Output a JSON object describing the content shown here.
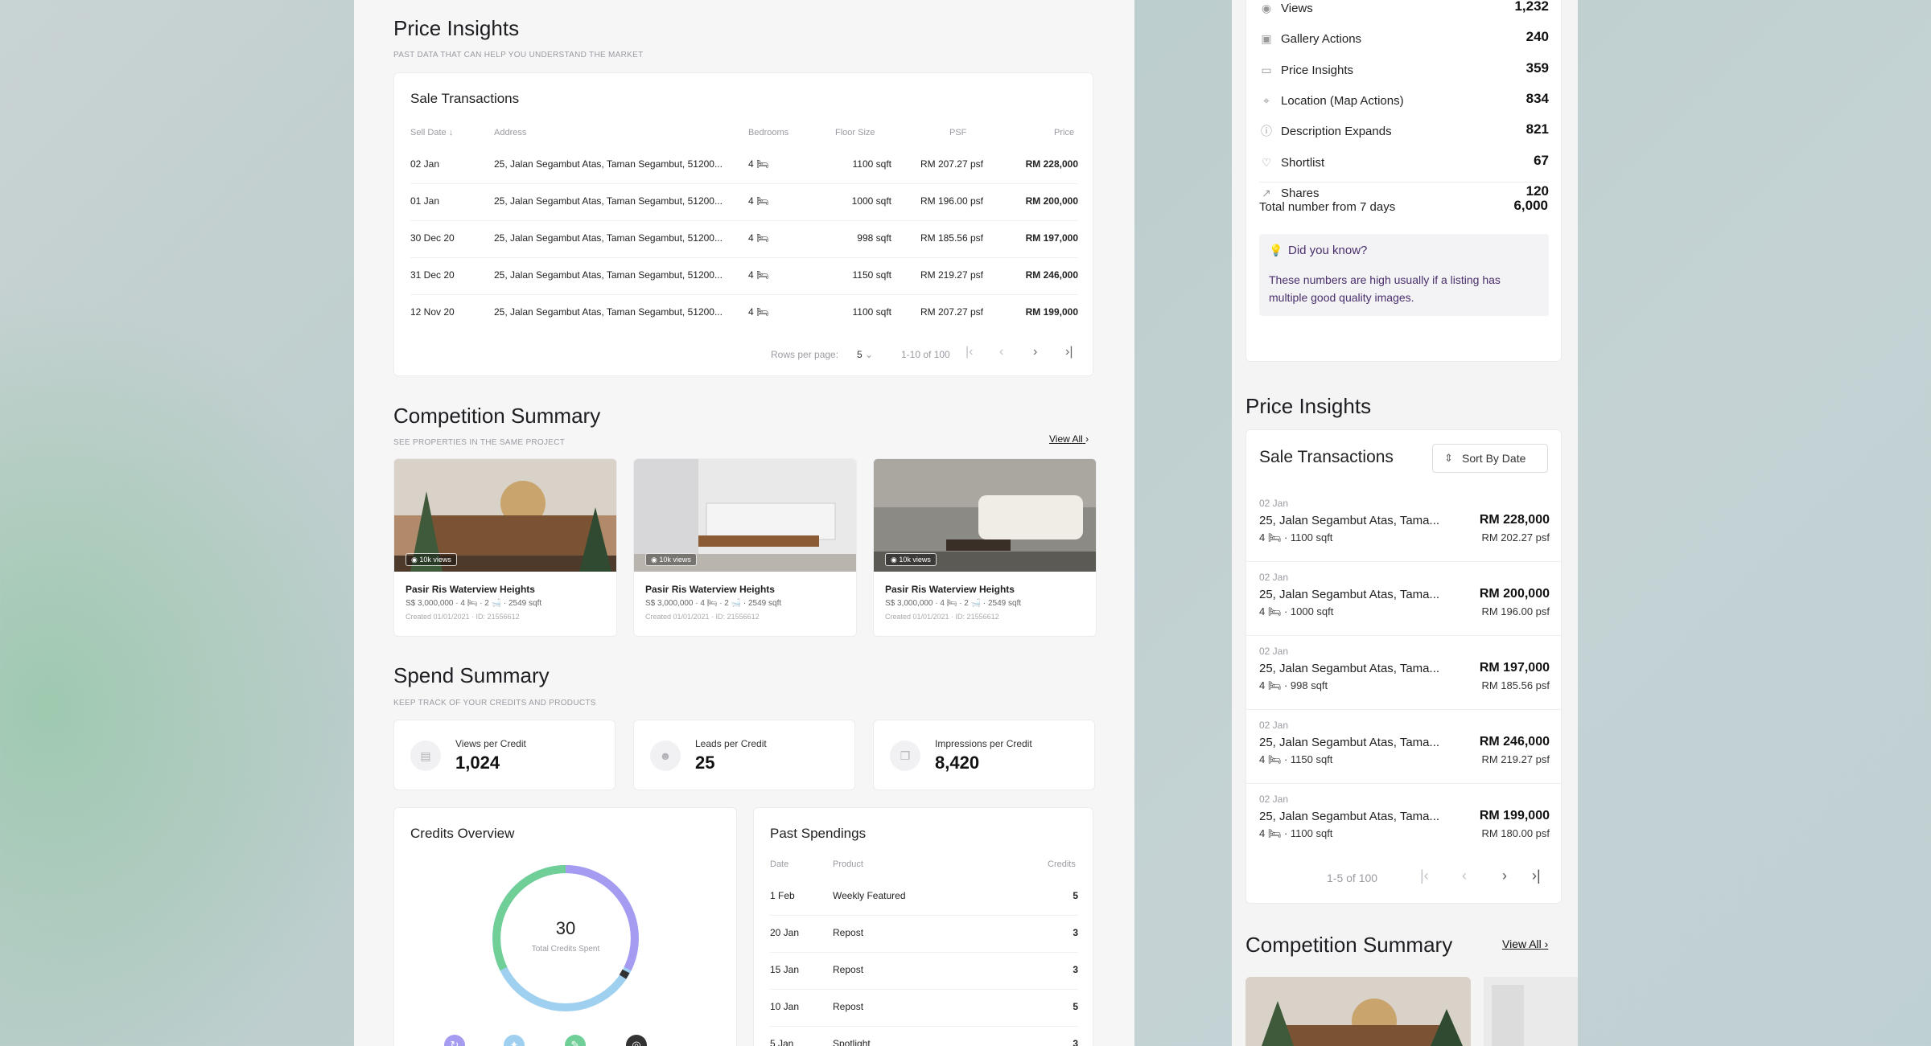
{
  "left": {
    "price_insights": {
      "title": "Price Insights",
      "subtitle": "PAST DATA THAT CAN HELP YOU UNDERSTAND THE MARKET",
      "card_title": "Sale Transactions",
      "columns": [
        "Sell Date",
        "Address",
        "Bedrooms",
        "Floor Size",
        "PSF",
        "Price"
      ],
      "rows": [
        {
          "date": "02 Jan",
          "address": "25, Jalan Segambut Atas, Taman Segambut, 51200...",
          "beds": "4",
          "size": "1100 sqft",
          "psf": "RM 207.27 psf",
          "price": "RM 228,000"
        },
        {
          "date": "01 Jan",
          "address": "25, Jalan Segambut Atas, Taman Segambut, 51200...",
          "beds": "4",
          "size": "1000 sqft",
          "psf": "RM 196.00 psf",
          "price": "RM 200,000"
        },
        {
          "date": "30 Dec 20",
          "address": "25, Jalan Segambut Atas, Taman Segambut, 51200...",
          "beds": "4",
          "size": "998 sqft",
          "psf": "RM 185.56 psf",
          "price": "RM 197,000"
        },
        {
          "date": "31 Dec 20",
          "address": "25, Jalan Segambut Atas, Taman Segambut, 51200...",
          "beds": "4",
          "size": "1150 sqft",
          "psf": "RM 219.27 psf",
          "price": "RM 246,000"
        },
        {
          "date": "12 Nov 20",
          "address": "25, Jalan Segambut Atas, Taman Segambut, 51200...",
          "beds": "4",
          "size": "1100 sqft",
          "psf": "RM 207.27 psf",
          "price": "RM 199,000"
        }
      ],
      "rows_per_page_label": "Rows per page:",
      "rows_per_page_value": "5",
      "range": "1-10 of 100"
    },
    "competition": {
      "title": "Competition Summary",
      "subtitle": "SEE PROPERTIES IN THE SAME PROJECT",
      "view_all": "View All",
      "listings": [
        {
          "views": "10k views",
          "name": "Pasir Ris Waterview Heights",
          "meta": "S$ 3,000,000  ·  4 🛏  ·  2 🛁  ·  2549 sqft",
          "sub": "Created 01/01/2021  ·  ID: 21556612"
        },
        {
          "views": "10k views",
          "name": "Pasir Ris Waterview Heights",
          "meta": "S$ 3,000,000  ·  4 🛏  ·  2 🛁  ·  2549 sqft",
          "sub": "Created 01/01/2021  ·  ID: 21556612"
        },
        {
          "views": "10k views",
          "name": "Pasir Ris Waterview Heights",
          "meta": "S$ 3,000,000  ·  4 🛏  ·  2 🛁  ·  2549 sqft",
          "sub": "Created 01/01/2021  ·  ID: 21556612"
        }
      ]
    },
    "spend": {
      "title": "Spend Summary",
      "subtitle": "KEEP TRACK OF YOUR CREDITS AND PRODUCTS",
      "stats": [
        {
          "label": "Views per Credit",
          "value": "1,024"
        },
        {
          "label": "Leads per Credit",
          "value": "25"
        },
        {
          "label": "Impressions per Credit",
          "value": "8,420"
        }
      ]
    },
    "credits": {
      "title": "Credits Overview",
      "total": "30",
      "total_label": "Total Credits Spent"
    },
    "past": {
      "title": "Past Spendings",
      "columns": [
        "Date",
        "Product",
        "Credits"
      ],
      "rows": [
        {
          "date": "1 Feb",
          "product": "Weekly Featured",
          "credits": "5"
        },
        {
          "date": "20 Jan",
          "product": "Repost",
          "credits": "3"
        },
        {
          "date": "15 Jan",
          "product": "Repost",
          "credits": "3"
        },
        {
          "date": "10 Jan",
          "product": "Repost",
          "credits": "5"
        },
        {
          "date": "5 Jan",
          "product": "Spotlight",
          "credits": "3"
        }
      ]
    }
  },
  "right": {
    "metrics": [
      {
        "label": "Views",
        "value": "1,232",
        "icon": "eye-icon"
      },
      {
        "label": "Gallery Actions",
        "value": "240",
        "icon": "gallery-icon"
      },
      {
        "label": "Price Insights",
        "value": "359",
        "icon": "price-icon"
      },
      {
        "label": "Location (Map Actions)",
        "value": "834",
        "icon": "map-icon"
      },
      {
        "label": "Description Expands",
        "value": "821",
        "icon": "info-icon"
      },
      {
        "label": "Shortlist",
        "value": "67",
        "icon": "heart-icon"
      },
      {
        "label": "Shares",
        "value": "120",
        "icon": "share-icon"
      }
    ],
    "total_label": "Total number from 7 days",
    "total_value": "6,000",
    "tip_title": "Did you know?",
    "tip_text": "These numbers are high usually if a listing has multiple good quality images.",
    "price_title": "Price Insights",
    "sale_title": "Sale Transactions",
    "sort_label": "Sort By Date",
    "transactions": [
      {
        "date": "02 Jan",
        "address": "25, Jalan Segambut Atas, Tama...",
        "meta": "4 🛏 · 1100 sqft",
        "price": "RM 228,000",
        "psf": "RM 202.27 psf"
      },
      {
        "date": "02 Jan",
        "address": "25, Jalan Segambut Atas, Tama...",
        "meta": "4 🛏 · 1000 sqft",
        "price": "RM 200,000",
        "psf": "RM 196.00 psf"
      },
      {
        "date": "02 Jan",
        "address": "25, Jalan Segambut Atas, Tama...",
        "meta": "4 🛏 · 998 sqft",
        "price": "RM 197,000",
        "psf": "RM 185.56 psf"
      },
      {
        "date": "02 Jan",
        "address": "25, Jalan Segambut Atas, Tama...",
        "meta": "4 🛏 · 1150 sqft",
        "price": "RM 246,000",
        "psf": "RM 219.27 psf"
      },
      {
        "date": "02 Jan",
        "address": "25, Jalan Segambut Atas, Tama...",
        "meta": "4 🛏 · 1100 sqft",
        "price": "RM 199,000",
        "psf": "RM 180.00 psf"
      }
    ],
    "range": "1-5 of 100",
    "comp_title": "Competition Summary",
    "comp_view_all": "View All"
  },
  "colors": {
    "purple": "#a59cf2",
    "blue": "#9fd0ef",
    "green": "#6fcf97",
    "tip_text": "#4a2f6b"
  }
}
